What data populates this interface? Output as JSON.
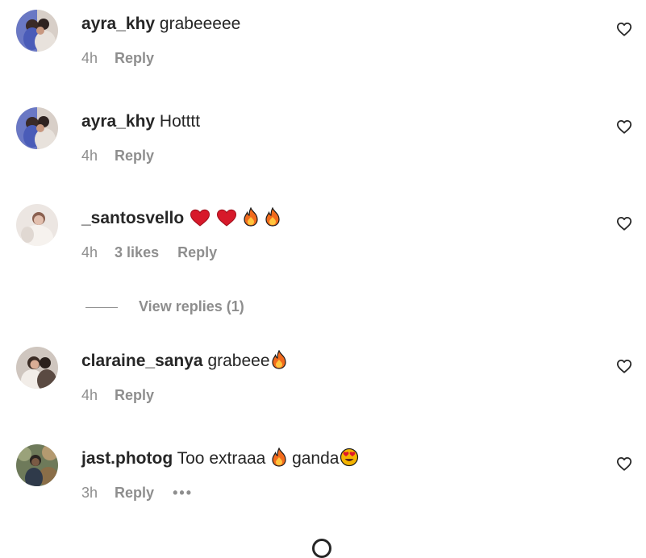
{
  "comments": [
    {
      "username": "ayra_khy",
      "text": "grabeeeee",
      "time": "4h",
      "likes": "",
      "reply_label": "Reply",
      "avatar": "avatar-couple-photo"
    },
    {
      "username": "ayra_khy",
      "text": "Hotttt",
      "time": "4h",
      "likes": "",
      "reply_label": "Reply",
      "avatar": "avatar-couple-photo"
    },
    {
      "username": "_santosvello",
      "text": "",
      "emojis": [
        "red-heart-emoji",
        "red-heart-emoji",
        "fire-emoji",
        "fire-emoji"
      ],
      "time": "4h",
      "likes": "3 likes",
      "reply_label": "Reply",
      "avatar": "avatar-bride-photo"
    },
    {
      "username": "claraine_sanya",
      "text": "grabeee",
      "emojis": [
        "fire-emoji"
      ],
      "time": "4h",
      "likes": "",
      "reply_label": "Reply",
      "avatar": "avatar-wedding-photo"
    },
    {
      "username": "jast.photog",
      "text_before": "Too extraaa",
      "text_after": "ganda",
      "emojis": [
        "fire-emoji",
        "heart-eyes-emoji"
      ],
      "time": "3h",
      "likes": "",
      "reply_label": "Reply",
      "more_label": "•••",
      "avatar": "avatar-man-outdoor-photo"
    }
  ],
  "view_replies": "View replies (1)",
  "icons": {
    "like": "heart-outline-icon",
    "loading": "loading-spinner-icon"
  },
  "colors": {
    "text": "#262626",
    "secondary": "#8e8e8e",
    "background": "#ffffff"
  }
}
